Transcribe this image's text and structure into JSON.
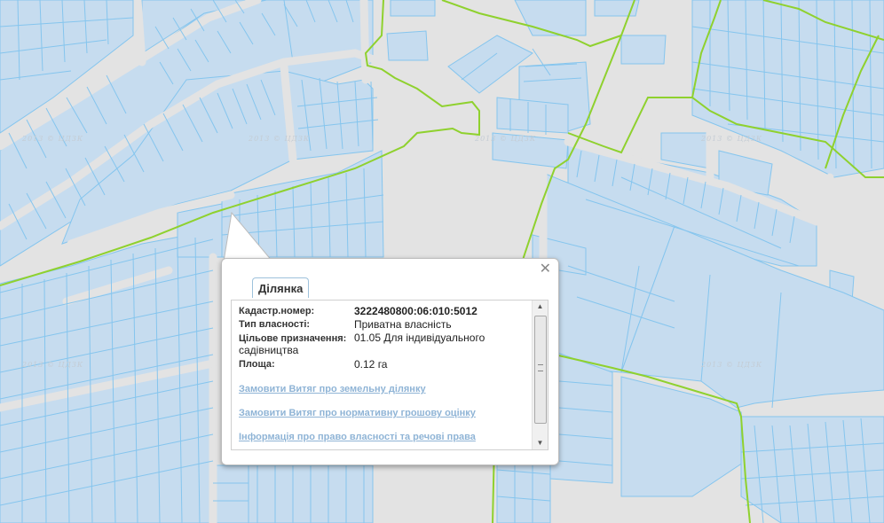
{
  "map": {
    "watermark": "2013 © ЦДЗК",
    "colors": {
      "background": "#e3e3e3",
      "parcel_fill": "#c6dcef",
      "parcel_stroke": "#85c5ee",
      "boundary": "#8fd12e"
    }
  },
  "popup": {
    "tab_label": "Ділянка",
    "close_icon": "close-icon",
    "fields": [
      {
        "label": "Кадастр.номер:",
        "value": "3222480800:06:010:5012"
      },
      {
        "label": "Тип власності:",
        "value": "Приватна власність"
      },
      {
        "label": "Цільове призначення:",
        "value": "01.05 Для індивідуального садівництва"
      },
      {
        "label": "Площа:",
        "value": "0.12 га"
      }
    ],
    "links": [
      "Замовити Витяг про земельну ділянку",
      "Замовити Витяг про нормативну грошову оцінку",
      "Інформація про право власності та речові права"
    ]
  }
}
